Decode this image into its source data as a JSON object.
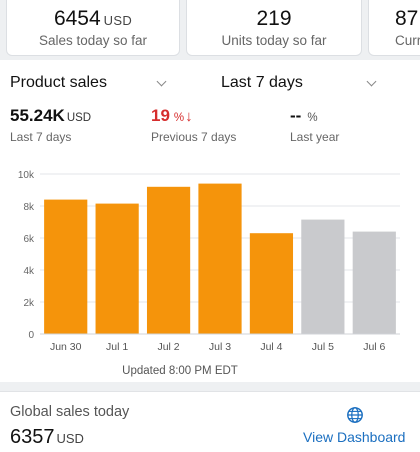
{
  "kpis": [
    {
      "value": "6454",
      "unit": "USD",
      "label": "Sales today so far"
    },
    {
      "value": "219",
      "unit": "",
      "label": "Units today so far"
    },
    {
      "value": "87",
      "unit": "",
      "label": "Curr"
    }
  ],
  "filters": {
    "metric": "Product sales",
    "range": "Last 7 days"
  },
  "metrics": [
    {
      "value": "55.24K",
      "unit": "USD",
      "arrow": "",
      "label": "Last 7 days"
    },
    {
      "value": "19",
      "unit": "%",
      "arrow": "↓",
      "label": "Previous 7 days"
    },
    {
      "value": "--",
      "unit": "%",
      "arrow": "",
      "label": "Last year"
    }
  ],
  "chart_data": {
    "type": "bar",
    "categories": [
      "Jun 30",
      "Jul 1",
      "Jul 2",
      "Jul 3",
      "Jul 4",
      "Jul 5",
      "Jul 6"
    ],
    "values": [
      8400,
      8150,
      9200,
      9400,
      6300,
      7150,
      6400
    ],
    "bar_colors": [
      "#f5940b",
      "#f5940b",
      "#f5940b",
      "#f5940b",
      "#f5940b",
      "#c9cacd",
      "#c9cacd"
    ],
    "y_ticks": [
      "0",
      "2k",
      "4k",
      "6k",
      "8k",
      "10k"
    ],
    "ylim": [
      0,
      10000
    ],
    "grid": true,
    "footnote": "Updated 8:00 PM EDT"
  },
  "global": {
    "label": "Global sales today",
    "value": "6357",
    "unit": "USD",
    "link": "View Dashboard",
    "icon": "globe-icon"
  },
  "colors": {
    "accent": "#f5940b",
    "inactive_bar": "#c9cacd",
    "decline": "#d62d2d",
    "link": "#1b6fc0"
  }
}
